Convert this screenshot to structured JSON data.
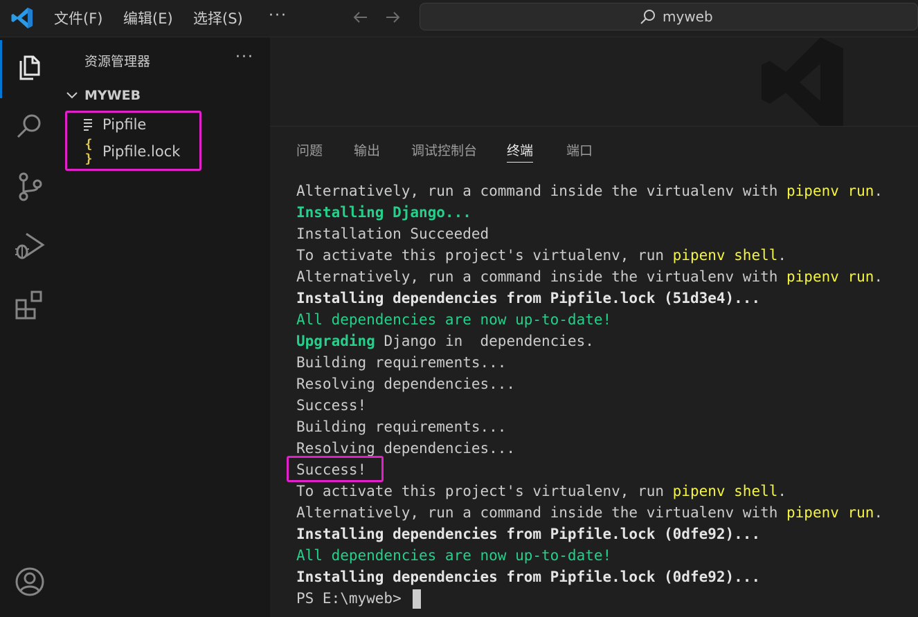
{
  "titlebar": {
    "menu": [
      "文件(F)",
      "编辑(E)",
      "选择(S)"
    ],
    "more": "···",
    "search": "myweb"
  },
  "sidebar": {
    "title": "资源管理器",
    "more": "···",
    "folder": "MYWEB",
    "files": [
      {
        "name": "Pipfile",
        "icon": "lines-icon"
      },
      {
        "name": "Pipfile.lock",
        "icon": "json-braces-icon",
        "glyph": "{ }"
      }
    ]
  },
  "panel": {
    "tabs": [
      "问题",
      "输出",
      "调试控制台",
      "终端",
      "端口"
    ],
    "active_tab": "终端"
  },
  "terminal": {
    "lines": [
      [
        {
          "t": "Alternatively, run a command inside the virtualenv with ",
          "c": ""
        },
        {
          "t": "pipenv run",
          "c": "y"
        },
        {
          "t": ".",
          "c": ""
        }
      ],
      [
        {
          "t": "Installing Django...",
          "c": "gb"
        }
      ],
      [
        {
          "t": "Installation Succeeded",
          "c": ""
        }
      ],
      [
        {
          "t": "To activate this project's virtualenv, run ",
          "c": ""
        },
        {
          "t": "pipenv shell",
          "c": "y"
        },
        {
          "t": ".",
          "c": ""
        }
      ],
      [
        {
          "t": "Alternatively, run a command inside the virtualenv with ",
          "c": ""
        },
        {
          "t": "pipenv run",
          "c": "y"
        },
        {
          "t": ".",
          "c": ""
        }
      ],
      [
        {
          "t": "Installing dependencies from Pipfile.lock (51d3e4)...",
          "c": "b"
        }
      ],
      [
        {
          "t": "All dependencies are now up-to-date!",
          "c": "g"
        }
      ],
      [
        {
          "t": "Upgrading",
          "c": "gb"
        },
        {
          "t": " Django in  dependencies.",
          "c": ""
        }
      ],
      [
        {
          "t": "Building requirements...",
          "c": ""
        }
      ],
      [
        {
          "t": "Resolving dependencies...",
          "c": ""
        }
      ],
      [
        {
          "t": "Success!",
          "c": ""
        }
      ],
      [
        {
          "t": "Building requirements...",
          "c": ""
        }
      ],
      [
        {
          "t": "Resolving dependencies...",
          "c": ""
        }
      ],
      [
        {
          "t": "Success!",
          "c": ""
        }
      ],
      [
        {
          "t": "To activate this project's virtualenv, run ",
          "c": ""
        },
        {
          "t": "pipenv shell",
          "c": "y"
        },
        {
          "t": ".",
          "c": ""
        }
      ],
      [
        {
          "t": "Alternatively, run a command inside the virtualenv with ",
          "c": ""
        },
        {
          "t": "pipenv run",
          "c": "y"
        },
        {
          "t": ".",
          "c": ""
        }
      ],
      [
        {
          "t": "Installing dependencies from Pipfile.lock (0dfe92)...",
          "c": "b"
        }
      ],
      [
        {
          "t": "All dependencies are now up-to-date!",
          "c": "g"
        }
      ],
      [
        {
          "t": "Installing dependencies from Pipfile.lock (0dfe92)...",
          "c": "b"
        }
      ]
    ],
    "prompt": "PS E:\\myweb> "
  },
  "colors": {
    "accent": "#0078d4",
    "highlight": "#e020c8",
    "success_green": "#23d18b",
    "command_yellow": "#f5f543"
  }
}
